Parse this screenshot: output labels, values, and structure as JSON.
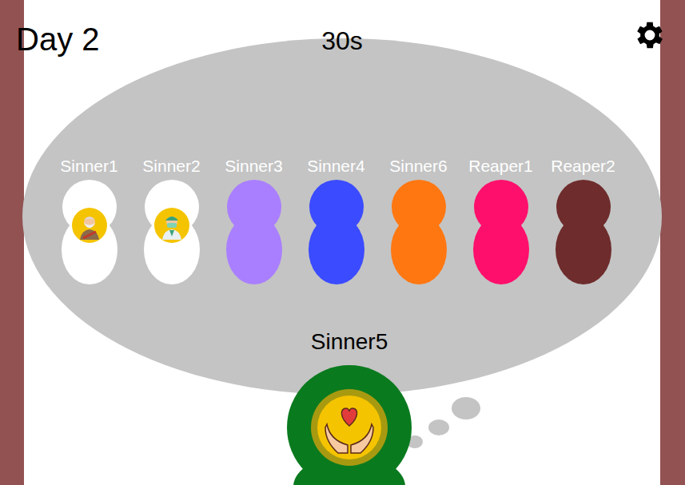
{
  "day": "Day 2",
  "timer": "30s",
  "players": [
    {
      "name": "Sinner1",
      "color": "#ffffff",
      "kind": "monk"
    },
    {
      "name": "Sinner2",
      "color": "#ffffff",
      "kind": "doctor"
    },
    {
      "name": "Sinner3",
      "color": "#a97fff",
      "kind": "plain"
    },
    {
      "name": "Sinner4",
      "color": "#3b4bff",
      "kind": "plain"
    },
    {
      "name": "Sinner6",
      "color": "#ff7711",
      "kind": "plain"
    },
    {
      "name": "Reaper1",
      "color": "#ff0f6c",
      "kind": "plain"
    },
    {
      "name": "Reaper2",
      "color": "#6e2c2c",
      "kind": "plain"
    }
  ],
  "self": {
    "name": "Sinner5",
    "color": "#0a7a1e"
  }
}
